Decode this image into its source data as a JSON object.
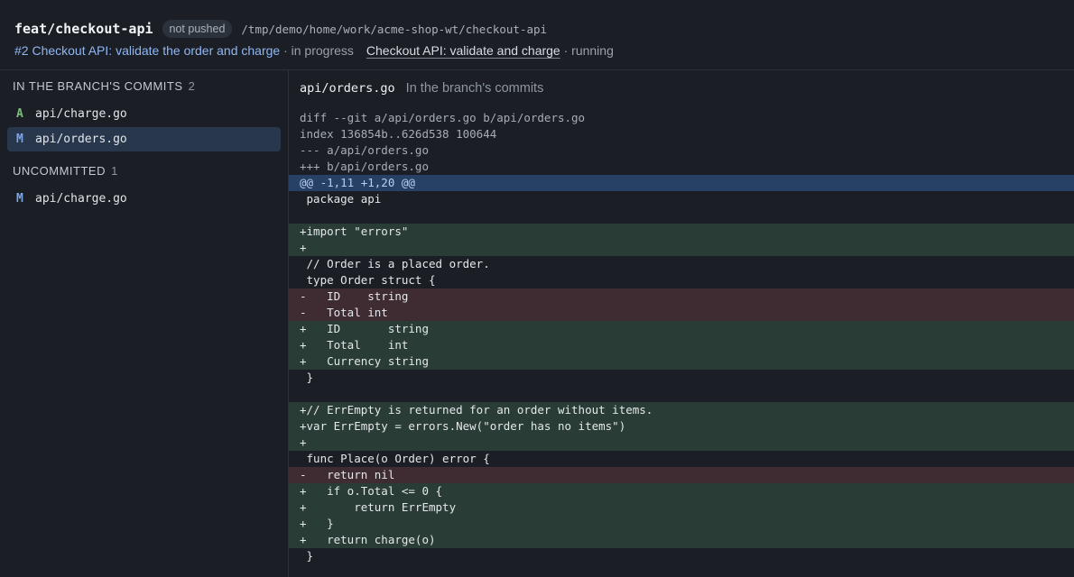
{
  "header": {
    "branch_name": "feat/checkout-api",
    "push_status": "not pushed",
    "worktree_path": "/tmp/demo/home/work/acme-shop-wt/checkout-api",
    "issue_link": "#2 Checkout API: validate the order and charge",
    "issue_state": "· in progress",
    "task_link": "Checkout API: validate and charge",
    "task_state": "· running"
  },
  "sidebar": {
    "committed": {
      "title": "IN THE BRANCH'S COMMITS",
      "count": "2",
      "files": [
        {
          "status": "A",
          "name": "api/charge.go"
        },
        {
          "status": "M",
          "name": "api/orders.go"
        }
      ]
    },
    "uncommitted": {
      "title": "UNCOMMITTED",
      "count": "1",
      "files": [
        {
          "status": "M",
          "name": "api/charge.go"
        }
      ]
    }
  },
  "diff": {
    "file": "api/orders.go",
    "context": "In the branch's commits",
    "lines": [
      {
        "type": "meta",
        "text": "diff --git a/api/orders.go b/api/orders.go"
      },
      {
        "type": "meta",
        "text": "index 136854b..626d538 100644"
      },
      {
        "type": "meta",
        "text": "--- a/api/orders.go"
      },
      {
        "type": "meta",
        "text": "+++ b/api/orders.go"
      },
      {
        "type": "hunk",
        "text": "@@ -1,11 +1,20 @@"
      },
      {
        "type": "ctx",
        "text": " package api"
      },
      {
        "type": "ctx",
        "text": ""
      },
      {
        "type": "add",
        "text": "+import \"errors\""
      },
      {
        "type": "add",
        "text": "+"
      },
      {
        "type": "ctx",
        "text": " // Order is a placed order."
      },
      {
        "type": "ctx",
        "text": " type Order struct {"
      },
      {
        "type": "del",
        "text": "-   ID    string"
      },
      {
        "type": "del",
        "text": "-   Total int"
      },
      {
        "type": "add",
        "text": "+   ID       string"
      },
      {
        "type": "add",
        "text": "+   Total    int"
      },
      {
        "type": "add",
        "text": "+   Currency string"
      },
      {
        "type": "ctx",
        "text": " }"
      },
      {
        "type": "ctx",
        "text": ""
      },
      {
        "type": "add",
        "text": "+// ErrEmpty is returned for an order without items."
      },
      {
        "type": "add",
        "text": "+var ErrEmpty = errors.New(\"order has no items\")"
      },
      {
        "type": "add",
        "text": "+"
      },
      {
        "type": "ctx",
        "text": " func Place(o Order) error {"
      },
      {
        "type": "del",
        "text": "-   return nil"
      },
      {
        "type": "add",
        "text": "+   if o.Total <= 0 {"
      },
      {
        "type": "add",
        "text": "+       return ErrEmpty"
      },
      {
        "type": "add",
        "text": "+   }"
      },
      {
        "type": "add",
        "text": "+   return charge(o)"
      },
      {
        "type": "ctx",
        "text": " }"
      }
    ]
  }
}
